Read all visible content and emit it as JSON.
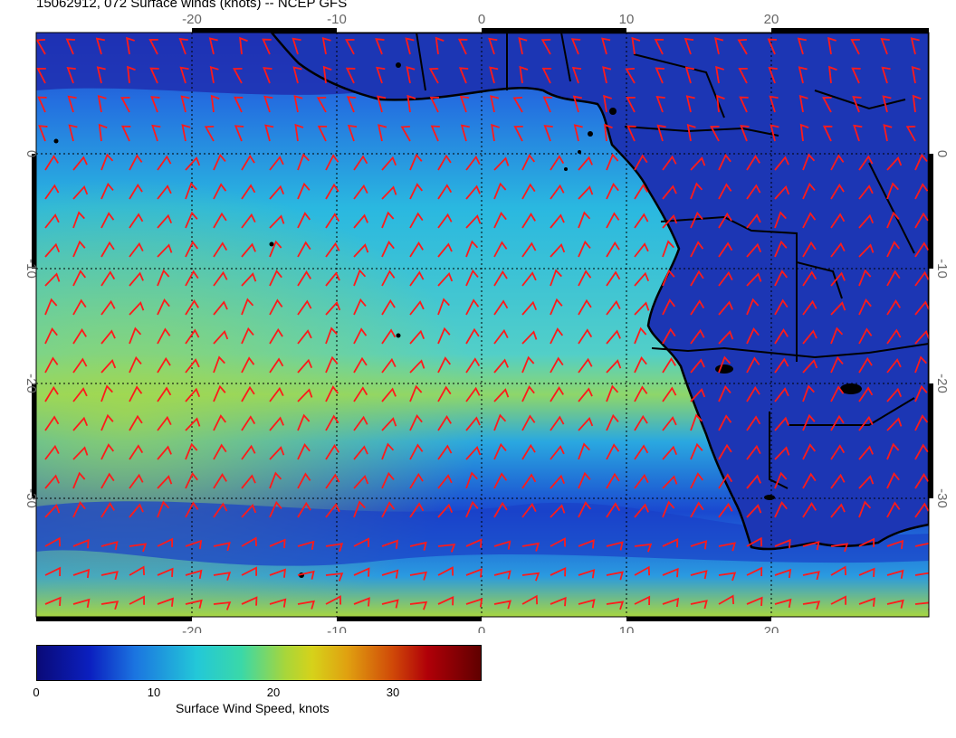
{
  "header": {
    "title": "15062912, 072 Surface winds (knots) -- NCEP GFS"
  },
  "map": {
    "x_ticks": [
      -20,
      -10,
      0,
      10,
      20
    ],
    "y_ticks": [
      0,
      -10,
      -20,
      -30
    ],
    "lon_range": [
      -30,
      31
    ],
    "lat_range": [
      9,
      -40
    ],
    "colors": {
      "land": "#1c36b4",
      "ocean_low": "#1a48d8",
      "ocean_mid": "#2ab8e0",
      "ocean_high": "#8ed66a",
      "barbs": "#ff1a1a",
      "coast": "#000000"
    }
  },
  "colorbar": {
    "label": "Surface Wind Speed, knots",
    "ticks": [
      "0",
      "10",
      "20",
      "30"
    ],
    "range": [
      0,
      38
    ]
  }
}
